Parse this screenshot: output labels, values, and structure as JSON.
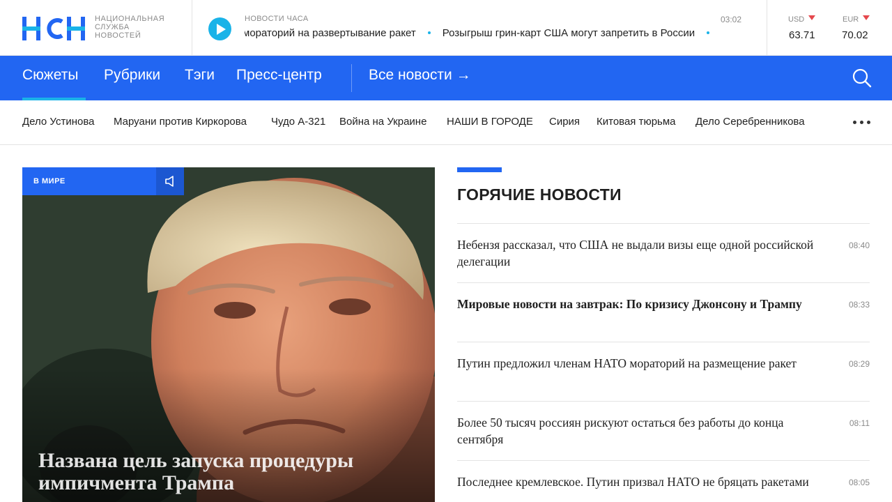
{
  "colors": {
    "brand_blue": "#2266f2",
    "accent_cyan": "#1ab3e8",
    "down_arrow": "#e5484d"
  },
  "header": {
    "logo_text": "НСН",
    "logo_caption": [
      "НАЦИОНАЛЬНАЯ",
      "СЛУЖБА",
      "НОВОСТЕЙ"
    ],
    "ticker_label": "НОВОСТИ ЧАСА",
    "ticker_time": "03:02",
    "ticker_items": [
      "мораторий на развертывание ракет",
      "Розыгрыш грин-карт США могут запретить в России"
    ],
    "currencies": [
      {
        "code": "USD",
        "value": "63.71",
        "trend_icon": "arrow-down-icon"
      },
      {
        "code": "EUR",
        "value": "70.02",
        "trend_icon": "arrow-down-icon"
      }
    ]
  },
  "nav": {
    "items": [
      "Сюжеты",
      "Рубрики",
      "Тэги",
      "Пресс-центр"
    ],
    "all_news": "Все новости →",
    "active": "Сюжеты"
  },
  "topics": [
    "Дело Устинова",
    "Маруани против Киркорова",
    "Чудо А-321",
    "Война на Украине",
    "НАШИ В ГОРОДЕ",
    "Сирия",
    "Китовая тюрьма",
    "Дело Серебренникова"
  ],
  "hero": {
    "tag": "В МИРЕ",
    "title": "Названа цель запуска процедуры импичмента Трампа"
  },
  "hot_news": {
    "title": "ГОРЯЧИЕ НОВОСТИ",
    "items": [
      {
        "text": "Небензя рассказал, что США не выдали визы еще одной российской делегации",
        "time": "08:40",
        "bold": false
      },
      {
        "text": "Мировые новости на завтрак: По кризису Джонсону и Трампу",
        "time": "08:33",
        "bold": true
      },
      {
        "text": "Путин предложил членам НАТО мораторий на размещение ракет",
        "time": "08:29",
        "bold": false
      },
      {
        "text": "Более 50 тысяч россиян рискуют остаться без работы до конца сентября",
        "time": "08:11",
        "bold": false
      },
      {
        "text": "Последнее кремлевское. Путин призвал НАТО не бряцать ракетами",
        "time": "08:05",
        "bold": false
      }
    ]
  }
}
